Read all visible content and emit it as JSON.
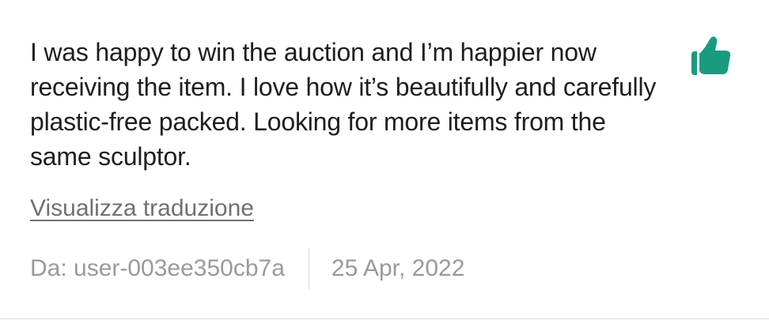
{
  "review": {
    "text": "I was happy to win the auction and I’m happier now receiving the item. I love how it’s beautifully and carefully plastic-free packed. Looking for more items from the same sculptor.",
    "translate_link": "Visualizza traduzione",
    "author": "Da: user-003ee350cb7a",
    "date": "25 Apr, 2022",
    "rating_icon": "thumbs-up-icon",
    "rating_color": "#1a9b7f"
  }
}
